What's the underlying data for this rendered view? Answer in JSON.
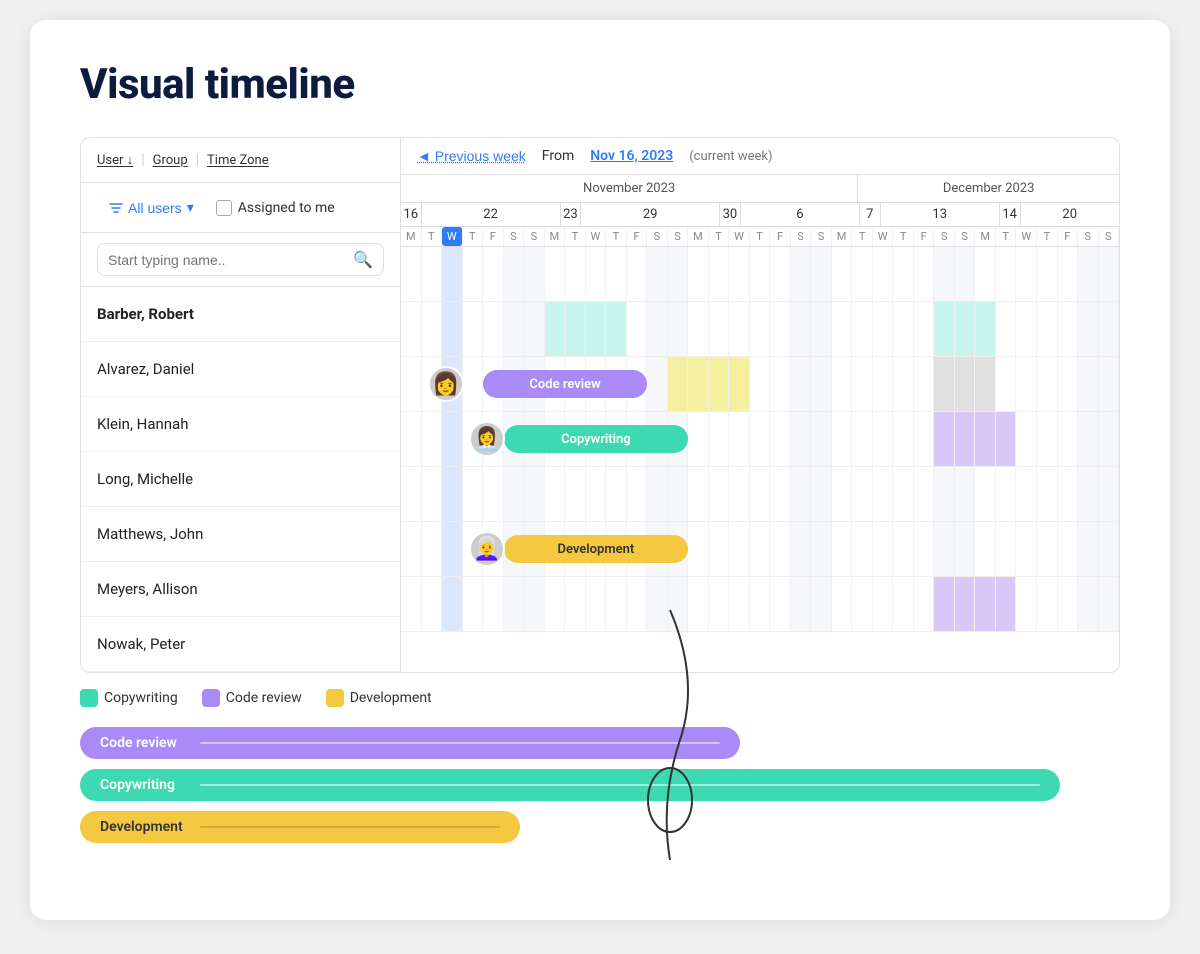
{
  "page": {
    "title": "Visual timeline"
  },
  "filters": {
    "user_label": "User",
    "group_label": "Group",
    "timezone_label": "Time Zone",
    "all_users_label": "All users",
    "assigned_label": "Assigned to me",
    "search_placeholder": "Start typing name.."
  },
  "users": [
    {
      "name": "Barber, Robert",
      "bold": true
    },
    {
      "name": "Alvarez, Daniel",
      "bold": false
    },
    {
      "name": "Klein, Hannah",
      "bold": false
    },
    {
      "name": "Long, Michelle",
      "bold": false
    },
    {
      "name": "Matthews, John",
      "bold": false
    },
    {
      "name": "Meyers, Allison",
      "bold": false
    },
    {
      "name": "Nowak, Peter",
      "bold": false
    }
  ],
  "timeline": {
    "prev_week_label": "◄ Previous week",
    "from_label": "From",
    "from_date": "Nov 16, 2023",
    "current_week_label": "(current week)",
    "months": [
      {
        "label": "November 2023",
        "cols": 14
      },
      {
        "label": "December 2023",
        "cols": 8
      }
    ],
    "week_starts": [
      "16",
      "22",
      "23",
      "29",
      "30",
      "6",
      "7",
      "13",
      "14",
      "20"
    ],
    "days": [
      "M",
      "T",
      "W",
      "T",
      "F",
      "S",
      "S",
      "M",
      "T",
      "W",
      "T",
      "F",
      "S",
      "S",
      "M",
      "T",
      "W",
      "T",
      "F",
      "S",
      "S",
      "M",
      "T",
      "W",
      "T",
      "F",
      "S",
      "S",
      "M",
      "T",
      "W",
      "T",
      "F",
      "S",
      "S"
    ]
  },
  "tasks": [
    {
      "label": "Code review",
      "type": "code-review",
      "row": 2,
      "start": 4,
      "span": 8
    },
    {
      "label": "Copywriting",
      "type": "copywriting",
      "row": 3,
      "start": 5,
      "span": 9
    },
    {
      "label": "Development",
      "type": "development",
      "row": 5,
      "start": 5,
      "span": 9
    }
  ],
  "legend": [
    {
      "label": "Copywriting",
      "type": "copywriting"
    },
    {
      "label": "Code review",
      "type": "code-review"
    },
    {
      "label": "Development",
      "type": "development"
    }
  ],
  "bottom_bars": [
    {
      "label": "Code review",
      "type": "code-review"
    },
    {
      "label": "Copywriting",
      "type": "copywriting"
    },
    {
      "label": "Development",
      "type": "development"
    }
  ]
}
